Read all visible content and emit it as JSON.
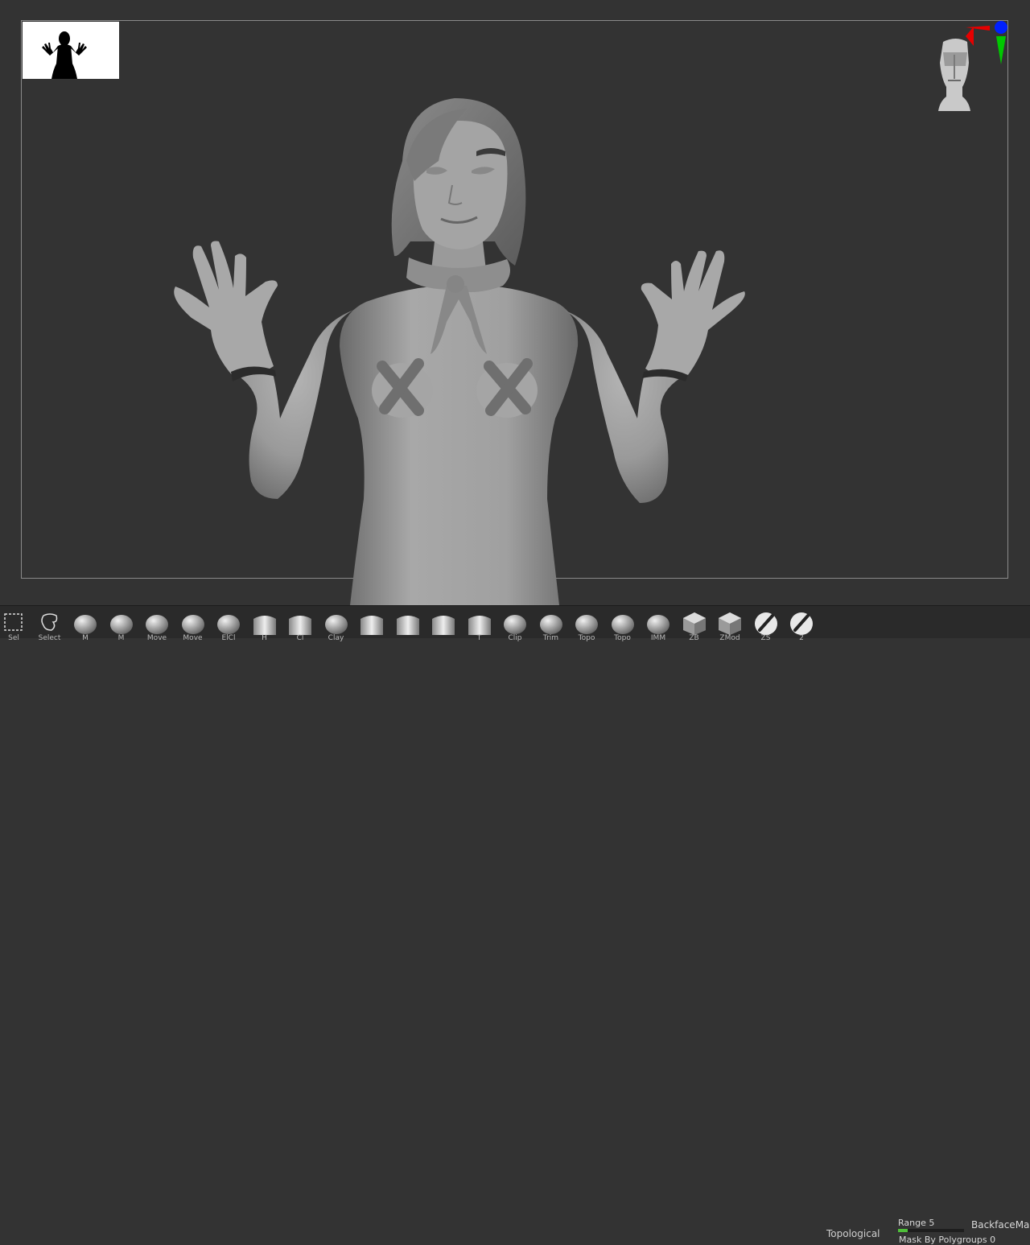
{
  "viewport": {
    "silhouette_icon": "character-silhouette-icon",
    "navigator_icon": "head-navigator-icon"
  },
  "shelf": {
    "tools": [
      {
        "name": "select-rect-tool",
        "icon": "dashed-rectangle-icon",
        "label": "Sel"
      },
      {
        "name": "select-lasso-tool",
        "icon": "lasso-icon",
        "label": "Select"
      },
      {
        "name": "brush-1",
        "icon": "sphere-brush-icon",
        "label": "M"
      },
      {
        "name": "brush-2",
        "icon": "sphere-brush-icon",
        "label": "M"
      },
      {
        "name": "brush-3",
        "icon": "sphere-brush-icon",
        "label": "Move"
      },
      {
        "name": "brush-4",
        "icon": "sphere-brush-icon",
        "label": "Move"
      },
      {
        "name": "brush-5",
        "icon": "sphere-brush-icon",
        "label": "ElCl"
      },
      {
        "name": "brush-6",
        "icon": "curve-brush-icon",
        "label": "H"
      },
      {
        "name": "brush-7",
        "icon": "curve-brush-icon",
        "label": "Cl"
      },
      {
        "name": "brush-8",
        "icon": "sphere-brush-icon",
        "label": "Clay"
      },
      {
        "name": "brush-9",
        "icon": "curve-brush-icon",
        "label": ""
      },
      {
        "name": "brush-10",
        "icon": "curve-brush-icon",
        "label": ""
      },
      {
        "name": "brush-11",
        "icon": "curve-brush-icon",
        "label": ""
      },
      {
        "name": "brush-12",
        "icon": "curve-brush-icon",
        "label": "T"
      },
      {
        "name": "brush-13",
        "icon": "sphere-brush-icon",
        "label": "Clip"
      },
      {
        "name": "brush-14",
        "icon": "sphere-brush-icon",
        "label": "Trim"
      },
      {
        "name": "brush-15",
        "icon": "sphere-brush-icon",
        "label": "Topo"
      },
      {
        "name": "brush-16",
        "icon": "sphere-brush-icon",
        "label": "Topo"
      },
      {
        "name": "brush-17",
        "icon": "sphere-brush-icon",
        "label": "IMM"
      },
      {
        "name": "brush-18",
        "icon": "cube-brush-icon",
        "label": "ZB"
      },
      {
        "name": "brush-19",
        "icon": "cube-brush-icon",
        "label": "ZMod"
      },
      {
        "name": "brush-20",
        "icon": "pen-brush-icon",
        "label": "ZS"
      },
      {
        "name": "brush-21",
        "icon": "pen-brush-icon",
        "label": "2"
      }
    ],
    "topological_label": "Topological",
    "range_label": "Range 5",
    "range_fraction": 0.15,
    "mask_by_polygroups_label": "Mask By Polygroups 0",
    "backface_label": "BackfaceMask"
  }
}
